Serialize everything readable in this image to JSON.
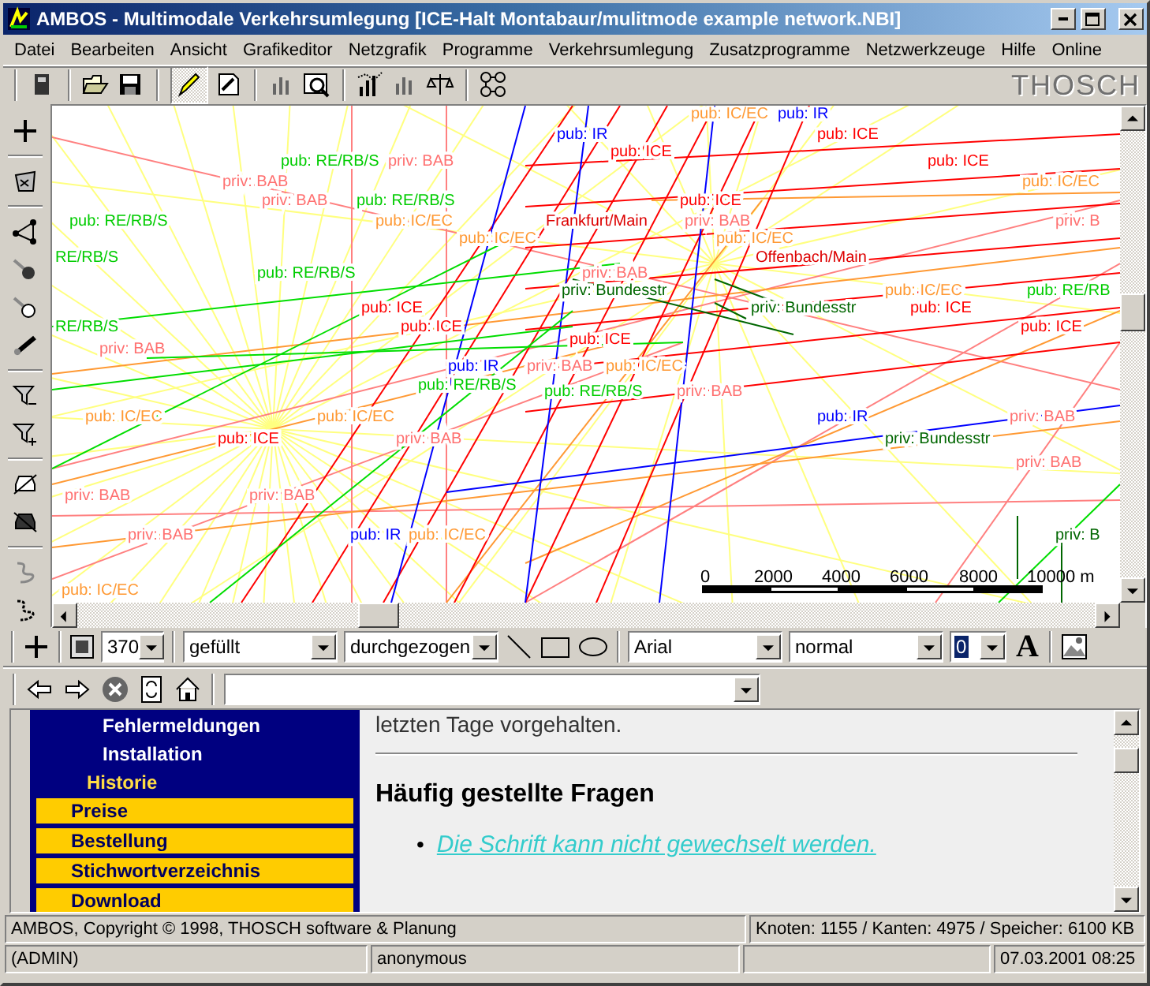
{
  "window": {
    "title": "AMBOS - Multimodale Verkehrsumlegung [ICE-Halt Montabaur/mulitmode example network.NBI]"
  },
  "menu": [
    "Datei",
    "Bearbeiten",
    "Ansicht",
    "Grafikeditor",
    "Netzgrafik",
    "Programme",
    "Verkehrsumlegung",
    "Zusatzprogramme",
    "Netzwerkzeuge",
    "Hilfe",
    "Online"
  ],
  "toolbar": {
    "logo": "THOSCH"
  },
  "map": {
    "labels": [
      {
        "text": "pub: IC/EC",
        "kind": "ic"
      },
      {
        "text": "pub: IR",
        "kind": "ir"
      },
      {
        "text": "pub: IR",
        "kind": "ir"
      },
      {
        "text": "pub: ICE",
        "kind": "ice"
      },
      {
        "text": "pub: RE/RB/S",
        "kind": "re"
      },
      {
        "text": "priv: BAB",
        "kind": "bab"
      },
      {
        "text": "pub: ICE",
        "kind": "ice"
      },
      {
        "text": "pub: ICE",
        "kind": "ice"
      },
      {
        "text": "priv: BAB",
        "kind": "bab"
      },
      {
        "text": "pub: IC/EC",
        "kind": "ic"
      },
      {
        "text": "priv: BAB",
        "kind": "bab"
      },
      {
        "text": "pub: RE/RB/S",
        "kind": "re"
      },
      {
        "text": "pub: ICE",
        "kind": "ice"
      },
      {
        "text": "pub: RE/RB/S",
        "kind": "re"
      },
      {
        "text": "pub: IC/EC",
        "kind": "ic"
      },
      {
        "text": "Frankfurt/Main",
        "kind": "city"
      },
      {
        "text": "priv: BAB",
        "kind": "bab"
      },
      {
        "text": "priv: B",
        "kind": "bab"
      },
      {
        "text": "pub: IC/EC",
        "kind": "ic"
      },
      {
        "text": "pub: IC/EC",
        "kind": "ic"
      },
      {
        "text": "RE/RB/S",
        "kind": "re"
      },
      {
        "text": "Offenbach/Main",
        "kind": "city"
      },
      {
        "text": "pub: RE/RB/S",
        "kind": "re"
      },
      {
        "text": "priv: BAB",
        "kind": "bab"
      },
      {
        "text": "priv: Bundesstr",
        "kind": "bundesstr"
      },
      {
        "text": "pub: IC/EC",
        "kind": "ic"
      },
      {
        "text": "pub: RE/RB",
        "kind": "re"
      },
      {
        "text": "pub: ICE",
        "kind": "ice"
      },
      {
        "text": "priv: Bundesstr",
        "kind": "bundesstr"
      },
      {
        "text": "pub: ICE",
        "kind": "ice"
      },
      {
        "text": "RE/RB/S",
        "kind": "re"
      },
      {
        "text": "pub: ICE",
        "kind": "ice"
      },
      {
        "text": "pub: ICE",
        "kind": "ice"
      },
      {
        "text": "pub: ICE",
        "kind": "ice"
      },
      {
        "text": "priv: BAB",
        "kind": "bab"
      },
      {
        "text": "pub: IR",
        "kind": "ir"
      },
      {
        "text": "priv: BAB",
        "kind": "bab"
      },
      {
        "text": "pub: IC/EC",
        "kind": "ic"
      },
      {
        "text": "pub: RE/RB/S",
        "kind": "re"
      },
      {
        "text": "pub: RE/RB/S",
        "kind": "re"
      },
      {
        "text": "priv: BAB",
        "kind": "bab"
      },
      {
        "text": "pub: IC/EC",
        "kind": "ic"
      },
      {
        "text": "pub: IC/EC",
        "kind": "ic"
      },
      {
        "text": "pub: IR",
        "kind": "ir"
      },
      {
        "text": "priv: BAB",
        "kind": "bab"
      },
      {
        "text": "pub: ICE",
        "kind": "ice"
      },
      {
        "text": "priv: BAB",
        "kind": "bab"
      },
      {
        "text": "priv: Bundesstr",
        "kind": "bundesstr"
      },
      {
        "text": "priv: BAB",
        "kind": "bab"
      },
      {
        "text": "priv: BAB",
        "kind": "bab"
      },
      {
        "text": "priv: BAB",
        "kind": "bab"
      },
      {
        "text": "priv: BAB",
        "kind": "bab"
      },
      {
        "text": "pub: IR",
        "kind": "ir"
      },
      {
        "text": "pub: IC/EC",
        "kind": "ic"
      },
      {
        "text": "priv: B",
        "kind": "bundesstr"
      },
      {
        "text": "pub: IC/EC",
        "kind": "ic"
      }
    ],
    "scale_labels": [
      "0",
      "2000",
      "4000",
      "6000",
      "8000",
      "10000 m"
    ]
  },
  "draw_toolbar": {
    "size": "370",
    "fill": "gefüllt",
    "line_style": "durchgezogen",
    "font": "Arial",
    "font_style": "normal",
    "font_size": "0",
    "font_button": "A"
  },
  "browser": {
    "nav": [
      {
        "label": "Fehlermeldungen",
        "kind": "sub",
        "selected": false
      },
      {
        "label": "Installation",
        "kind": "sub",
        "selected": false
      },
      {
        "label": "Historie",
        "kind": "sub",
        "selected": true
      },
      {
        "label": "Preise",
        "kind": "button",
        "selected": false
      },
      {
        "label": "Bestellung",
        "kind": "button",
        "selected": false
      },
      {
        "label": "Stichwortverzeichnis",
        "kind": "button",
        "selected": false
      },
      {
        "label": "Download",
        "kind": "button",
        "selected": false
      }
    ],
    "intro": "letzten Tage vorgehalten.",
    "heading": "Häufig gestellte Fragen",
    "links": [
      {
        "bullet": "•",
        "text": "Die Schrift kann nicht gewechselt werden."
      }
    ]
  },
  "status_bar": {
    "copyright": "AMBOS, Copyright © 1998, THOSCH software & Planung",
    "stats": "Knoten: 1155 / Kanten: 4975 / Speicher: 6100 KB",
    "role": "(ADMIN)",
    "user": "anonymous",
    "datetime": "07.03.2001 08:25"
  }
}
